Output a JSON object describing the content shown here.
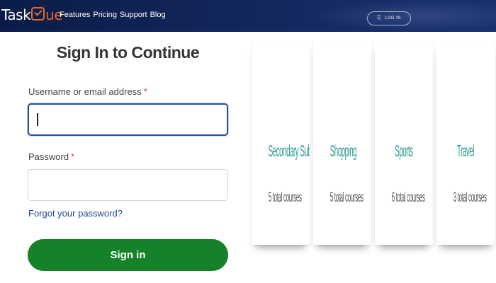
{
  "brand": {
    "logo_text_start": "Task",
    "logo_text_end": "ue",
    "accent_color": "#e5682b",
    "header_color": "#14285e"
  },
  "nav": {
    "items": [
      "Features",
      "Pricing",
      "Support",
      "Blog"
    ],
    "login_label": "LOG IN",
    "login_icon": "login-icon"
  },
  "form": {
    "title": "Sign In to Continue",
    "username_label": "Username or email address",
    "password_label": "Password",
    "required_marker": "*",
    "username_value": "",
    "password_value": "",
    "forgot_link": "Forgot your password?",
    "submit_label": "Sign in",
    "submit_color": "#15822a"
  },
  "categories": [
    {
      "title": "Secondary Subjects",
      "count": "5 total courses"
    },
    {
      "title": "Shopping",
      "count": "5 total courses"
    },
    {
      "title": "Sports",
      "count": "6 total courses"
    },
    {
      "title": "Travel",
      "count": "3 total courses"
    }
  ]
}
